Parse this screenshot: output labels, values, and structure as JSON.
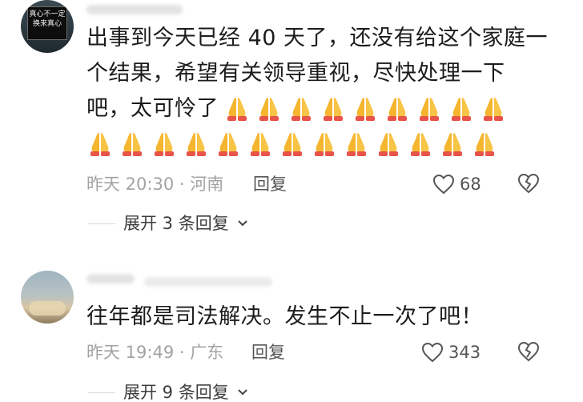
{
  "comments": [
    {
      "avatar_text": "真心不一定换来真心",
      "text_lines": [
        "出事到今天已经 40 天了，还没有给这个家庭一",
        "个结果，希望有关领导重视，尽快处理一下",
        "吧，太可怜了"
      ],
      "emoji_name": "folded-hands",
      "emoji_count_line3": 9,
      "emoji_count_line4": 13,
      "time": "昨天 20:30",
      "location": "河南",
      "meta_sep": "·",
      "reply_label": "回复",
      "like_count": "68",
      "expand_label": "展开 3 条回复"
    },
    {
      "text": "往年都是司法解决。发生不止一次了吧！",
      "time": "昨天 19:49",
      "location": "广东",
      "meta_sep": "·",
      "reply_label": "回复",
      "like_count": "343",
      "expand_label": "展开 9 条回复"
    }
  ]
}
